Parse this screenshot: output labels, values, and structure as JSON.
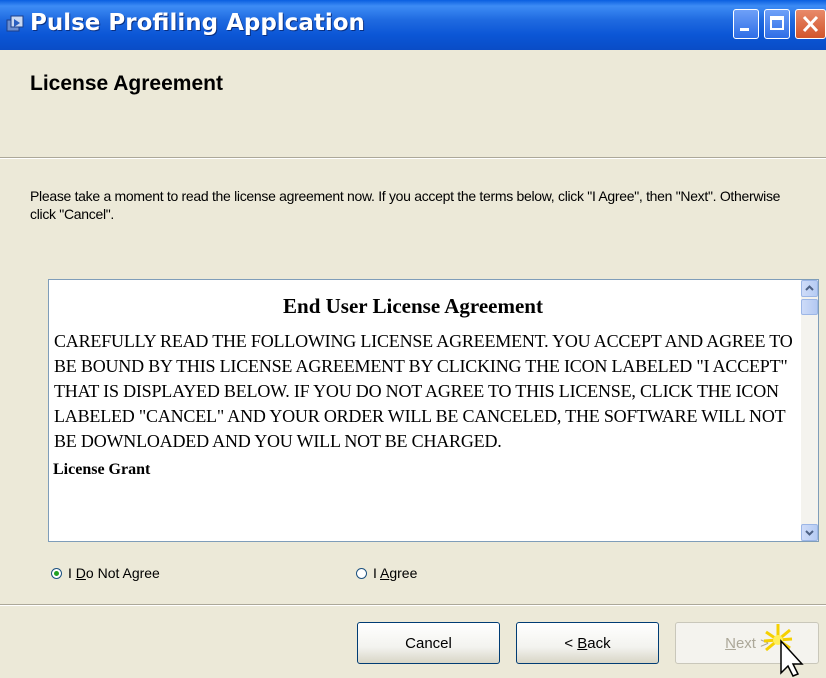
{
  "window": {
    "title": "Pulse Profiling Applcation",
    "controls": [
      "minimize",
      "maximize",
      "close"
    ]
  },
  "header": {
    "title": "License Agreement"
  },
  "instructions": "Please take a moment to read the license agreement now. If you accept the terms below, click \"I Agree\", then \"Next\". Otherwise click \"Cancel\".",
  "license": {
    "title": "End User License Agreement",
    "body": "CAREFULLY READ THE FOLLOWING LICENSE AGREEMENT. YOU ACCEPT AND AGREE TO BE BOUND BY THIS LICENSE AGREEMENT BY CLICKING THE ICON LABELED \"I ACCEPT\" THAT IS DISPLAYED BELOW. IF YOU DO NOT AGREE TO THIS LICENSE, CLICK THE ICON LABELED \"CANCEL\" AND YOUR ORDER WILL BE CANCELED, THE SOFTWARE WILL NOT BE DOWNLOADED AND YOU WILL NOT BE CHARGED.",
    "section_heading": "License Grant"
  },
  "options": {
    "do_not_agree": {
      "prefix": "I ",
      "accel": "D",
      "rest": "o Not Agree",
      "selected": true
    },
    "agree": {
      "prefix": "I ",
      "accel": "A",
      "rest": "gree",
      "selected": false
    }
  },
  "buttons": {
    "cancel": "Cancel",
    "back_arrow": "<",
    "back_accel": "B",
    "back_rest": "ack",
    "next_accel": "N",
    "next_rest": "ext",
    "next_arrow": ">"
  },
  "colors": {
    "titlebar": "#0b56d6",
    "dialog_bg": "#ece9d8",
    "radio_dot": "#21a121"
  }
}
